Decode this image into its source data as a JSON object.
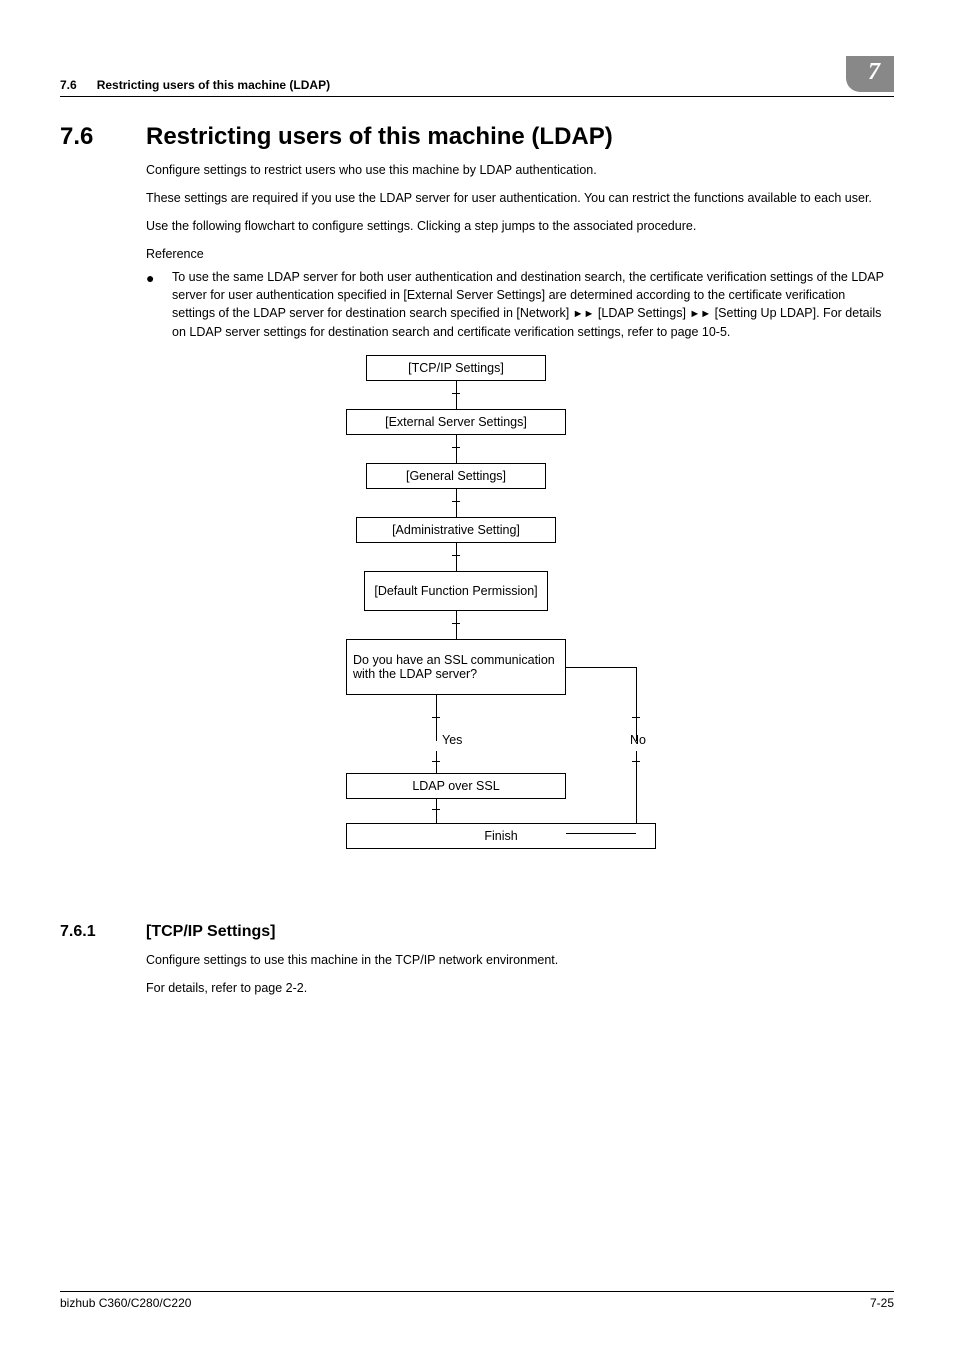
{
  "header": {
    "section_num": "7.6",
    "section_name": "Restricting users of this machine (LDAP)",
    "chapter_badge": "7"
  },
  "title": {
    "num": "7.6",
    "text": "Restricting users of this machine (LDAP)"
  },
  "paragraphs": {
    "p1": "Configure settings to restrict users who use this machine by LDAP authentication.",
    "p2": "These settings are required if you use the LDAP server for user authentication. You can restrict the functions available to each user.",
    "p3": "Use the following flowchart to configure settings. Clicking a step jumps to the associated procedure.",
    "ref": "Reference"
  },
  "bullet": {
    "pre": "To use the same LDAP server for both user authentication and destination search, the certificate verification settings of the LDAP server for user authentication specified in [External Server Settings] are determined according to the certificate verification settings of the LDAP server for destination search specified in [Network] ",
    "seg2": " [LDAP Settings] ",
    "seg3": " [Setting Up LDAP]. For details on LDAP server settings for destination search and certificate verification settings, refer to page 10-5."
  },
  "flow": {
    "b1": "[TCP/IP Settings]",
    "b2": "[External Server Settings]",
    "b3": "[General Settings]",
    "b4": "[Administrative Setting]",
    "b5": "[Default Function Permission]",
    "b6": "Do you have an SSL communication with the LDAP server?",
    "yes": "Yes",
    "no": "No",
    "b7": "LDAP over SSL",
    "b8": "Finish"
  },
  "subsection": {
    "num": "7.6.1",
    "title": "[TCP/IP Settings]",
    "p1": "Configure settings to use this machine in the TCP/IP network environment.",
    "p2": "For details, refer to page 2-2."
  },
  "footer": {
    "left": "bizhub C360/C280/C220",
    "right": "7-25"
  }
}
